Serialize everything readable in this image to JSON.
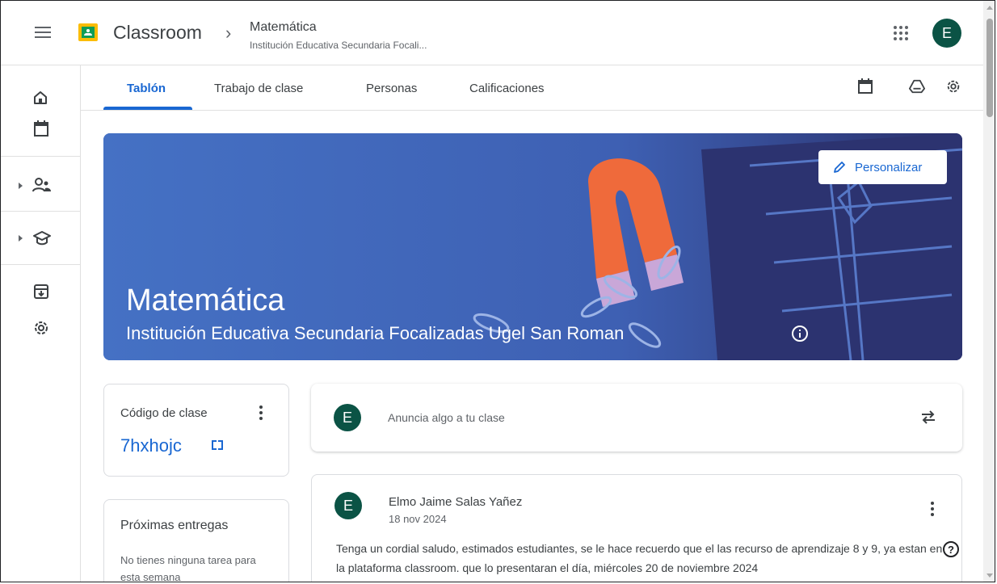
{
  "header": {
    "app_title": "Classroom",
    "class_name": "Matemática",
    "class_subtitle": "Institución Educativa Secundaria Focali...",
    "user_initial": "E"
  },
  "tabs": [
    {
      "label": "Tablón",
      "active": true
    },
    {
      "label": "Trabajo de clase",
      "active": false
    },
    {
      "label": "Personas",
      "active": false
    },
    {
      "label": "Calificaciones",
      "active": false
    }
  ],
  "banner": {
    "title": "Matemática",
    "subtitle": "Institución Educativa Secundaria Focalizadas Ugel San Roman",
    "customize_label": "Personalizar"
  },
  "class_code": {
    "label": "Código de clase",
    "value": "7hxhojc"
  },
  "upcoming": {
    "title": "Próximas entregas",
    "empty_text": "No tienes ninguna tarea para esta semana"
  },
  "announce": {
    "avatar_initial": "E",
    "placeholder": "Anuncia algo a tu clase"
  },
  "post": {
    "avatar_initial": "E",
    "author": "Elmo Jaime Salas Yañez",
    "date": "18 nov 2024",
    "body": "Tenga un cordial saludo, estimados estudiantes, se le hace recuerdo que el las recurso de aprendizaje 8 y 9, ya estan en la plataforma classroom. que lo presentaran el día, miércoles 20 de noviembre 2024"
  },
  "icons": {
    "menu": "hamburger-icon",
    "apps": "apps-grid-icon",
    "home": "home-icon",
    "calendar": "calendar-icon",
    "people": "people-icon",
    "school": "school-icon",
    "archive": "archive-icon",
    "settings": "settings-icon",
    "drive": "drive-icon",
    "edit": "pencil-icon",
    "info": "info-icon",
    "repost": "repost-icon",
    "help": "help-icon"
  },
  "colors": {
    "accent": "#1967d2",
    "banner": "#4166b8",
    "avatar": "#0b5345"
  }
}
